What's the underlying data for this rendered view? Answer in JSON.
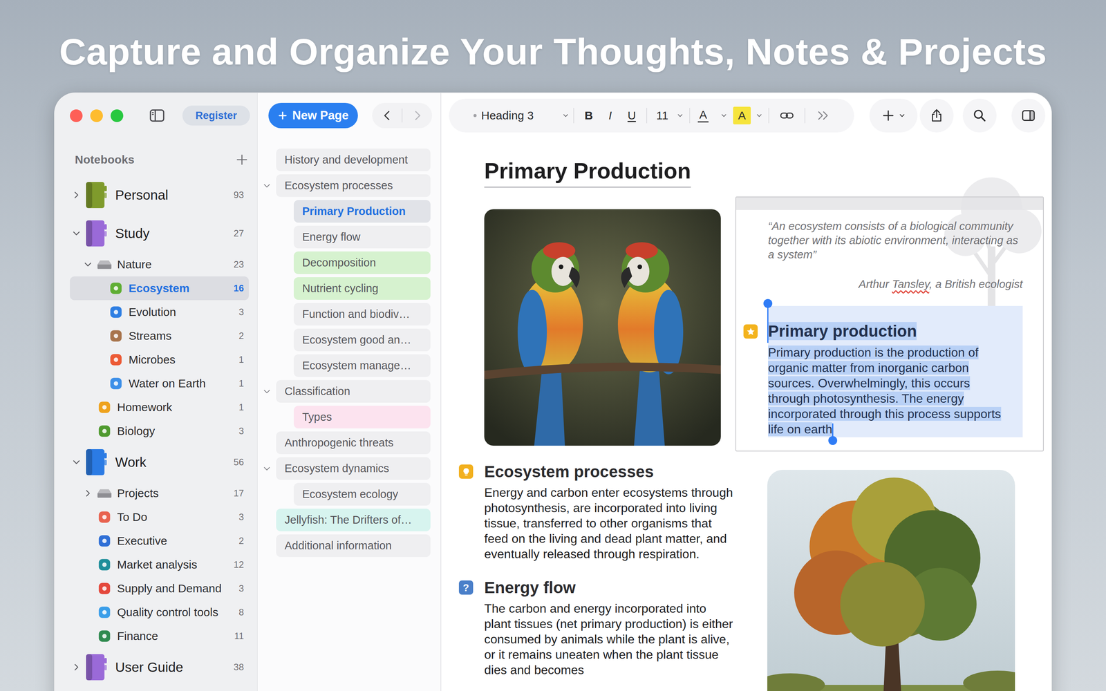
{
  "headline": "Capture and Organize Your Thoughts, Notes & Projects",
  "sidebar": {
    "register_button": "Register",
    "section_title": "Notebooks",
    "items": [
      {
        "label": "Personal",
        "count": "93",
        "kind": "notebook",
        "depth": 0,
        "collapsible": true,
        "expanded": false,
        "selected": false,
        "color": "#7f9b2c"
      },
      {
        "label": "Study",
        "count": "27",
        "kind": "notebook",
        "depth": 0,
        "collapsible": true,
        "expanded": true,
        "selected": false,
        "color": "#9a6ad8"
      },
      {
        "label": "Nature",
        "count": "23",
        "kind": "folder",
        "depth": 1,
        "collapsible": true,
        "expanded": true,
        "selected": false,
        "color": "#8e8e93"
      },
      {
        "label": "Ecosystem",
        "count": "16",
        "kind": "section",
        "depth": 2,
        "collapsible": false,
        "expanded": false,
        "selected": true,
        "color": "#5fae33"
      },
      {
        "label": "Evolution",
        "count": "3",
        "kind": "section",
        "depth": 2,
        "collapsible": false,
        "expanded": false,
        "selected": false,
        "color": "#2f7fe3"
      },
      {
        "label": "Streams",
        "count": "2",
        "kind": "section",
        "depth": 2,
        "collapsible": false,
        "expanded": false,
        "selected": false,
        "color": "#a8744c"
      },
      {
        "label": "Microbes",
        "count": "1",
        "kind": "section",
        "depth": 2,
        "collapsible": false,
        "expanded": false,
        "selected": false,
        "color": "#ec5a35"
      },
      {
        "label": "Water on Earth",
        "count": "1",
        "kind": "section",
        "depth": 2,
        "collapsible": false,
        "expanded": false,
        "selected": false,
        "color": "#3c8fe8"
      },
      {
        "label": "Homework",
        "count": "1",
        "kind": "section",
        "depth": 1,
        "collapsible": false,
        "expanded": false,
        "selected": false,
        "color": "#eea21c"
      },
      {
        "label": "Biology",
        "count": "3",
        "kind": "section",
        "depth": 1,
        "collapsible": false,
        "expanded": false,
        "selected": false,
        "color": "#4f9a2f"
      },
      {
        "label": "Work",
        "count": "56",
        "kind": "notebook",
        "depth": 0,
        "collapsible": true,
        "expanded": true,
        "selected": false,
        "color": "#2b7be4"
      },
      {
        "label": "Projects",
        "count": "17",
        "kind": "folder",
        "depth": 1,
        "collapsible": true,
        "expanded": false,
        "selected": false,
        "color": "#8e8e93"
      },
      {
        "label": "To Do",
        "count": "3",
        "kind": "section",
        "depth": 1,
        "collapsible": false,
        "expanded": false,
        "selected": false,
        "color": "#e8624f"
      },
      {
        "label": "Executive",
        "count": "2",
        "kind": "section",
        "depth": 1,
        "collapsible": false,
        "expanded": false,
        "selected": false,
        "color": "#2f6fd6"
      },
      {
        "label": "Market analysis",
        "count": "12",
        "kind": "section",
        "depth": 1,
        "collapsible": false,
        "expanded": false,
        "selected": false,
        "color": "#1d8e9a"
      },
      {
        "label": "Supply and Demand",
        "count": "3",
        "kind": "section",
        "depth": 1,
        "collapsible": false,
        "expanded": false,
        "selected": false,
        "color": "#e4483c"
      },
      {
        "label": "Quality control tools",
        "count": "8",
        "kind": "section",
        "depth": 1,
        "collapsible": false,
        "expanded": false,
        "selected": false,
        "color": "#3a9ee9"
      },
      {
        "label": "Finance",
        "count": "11",
        "kind": "section",
        "depth": 1,
        "collapsible": false,
        "expanded": false,
        "selected": false,
        "color": "#2f8a4f"
      },
      {
        "label": "User Guide",
        "count": "38",
        "kind": "notebook",
        "depth": 0,
        "collapsible": true,
        "expanded": false,
        "selected": false,
        "color": "#9a6ad8"
      }
    ]
  },
  "page_list": {
    "new_page_button": "New Page",
    "back_enabled": true,
    "forward_enabled": false,
    "pages": [
      {
        "title": "History and development",
        "depth": 0,
        "expandable": false,
        "expanded": false,
        "selected": false,
        "color": "#efeff1"
      },
      {
        "title": "Ecosystem processes",
        "depth": 0,
        "expandable": true,
        "expanded": true,
        "selected": false,
        "color": "#efeff1"
      },
      {
        "title": "Primary Production",
        "depth": 1,
        "expandable": false,
        "expanded": false,
        "selected": true,
        "color": "#e1e3e8"
      },
      {
        "title": "Energy flow",
        "depth": 1,
        "expandable": false,
        "expanded": false,
        "selected": false,
        "color": "#efeff1"
      },
      {
        "title": "Decomposition",
        "depth": 1,
        "expandable": false,
        "expanded": false,
        "selected": false,
        "color": "#d6f2cf"
      },
      {
        "title": "Nutrient cycling",
        "depth": 1,
        "expandable": false,
        "expanded": false,
        "selected": false,
        "color": "#d6f2cf"
      },
      {
        "title": "Function and biodiv…",
        "depth": 1,
        "expandable": false,
        "expanded": false,
        "selected": false,
        "color": "#efeff1"
      },
      {
        "title": "Ecosystem good an…",
        "depth": 1,
        "expandable": false,
        "expanded": false,
        "selected": false,
        "color": "#efeff1"
      },
      {
        "title": "Ecosystem manage…",
        "depth": 1,
        "expandable": false,
        "expanded": false,
        "selected": false,
        "color": "#efeff1"
      },
      {
        "title": "Classification",
        "depth": 0,
        "expandable": true,
        "expanded": true,
        "selected": false,
        "color": "#efeff1"
      },
      {
        "title": "Types",
        "depth": 1,
        "expandable": false,
        "expanded": false,
        "selected": false,
        "color": "#fce3ef"
      },
      {
        "title": "Anthropogenic threats",
        "depth": 0,
        "expandable": false,
        "expanded": false,
        "selected": false,
        "color": "#efeff1"
      },
      {
        "title": "Ecosystem dynamics",
        "depth": 0,
        "expandable": true,
        "expanded": true,
        "selected": false,
        "color": "#efeff1"
      },
      {
        "title": "Ecosystem ecology",
        "depth": 1,
        "expandable": false,
        "expanded": false,
        "selected": false,
        "color": "#efeff1"
      },
      {
        "title": "Jellyfish: The Drifters of…",
        "depth": 0,
        "expandable": false,
        "expanded": false,
        "selected": false,
        "color": "#d7f4ef"
      },
      {
        "title": "Additional information",
        "depth": 0,
        "expandable": false,
        "expanded": false,
        "selected": false,
        "color": "#efeff1"
      }
    ]
  },
  "toolbar": {
    "paragraph_style": "Heading 3",
    "styles": [
      {
        "label": "B",
        "kind": "bold"
      },
      {
        "label": "I",
        "kind": "italic"
      },
      {
        "label": "U",
        "kind": "underline"
      }
    ],
    "font_size": "11",
    "colors": [
      {
        "label": "A",
        "kind": "text",
        "color": "#3a3a3c"
      },
      {
        "label": "A",
        "kind": "highlight",
        "color": "#f6e43c"
      }
    ]
  },
  "document": {
    "title": "Primary Production",
    "quote": {
      "text": "“An ecosystem consists of a biological community together with its abiotic environment, interacting as a system”",
      "attribution": [
        {
          "text": "Arthur ",
          "misspelled": false
        },
        {
          "text": "Tansley",
          "misspelled": true
        },
        {
          "text": ", a British ecologist",
          "misspelled": false
        }
      ]
    },
    "note": {
      "heading": "Primary production",
      "body": "Primary production is the production of organic matter from inorganic carbon sources. Overwhelmingly, this occurs through photosynthesis. The energy incorporated through this process supports life on earth",
      "selected": true,
      "badge": {
        "kind": "star",
        "color": "#f3b31d"
      }
    },
    "sections": [
      {
        "heading": "Ecosystem processes",
        "body": "Energy and carbon enter ecosystems through photosynthesis, are incorporated into living tissue, transferred to other organisms that feed on the living and dead plant matter, and eventually released through respiration.",
        "badge": {
          "kind": "idea",
          "color": "#f2b01e"
        }
      },
      {
        "heading": "Energy flow",
        "body": "The carbon and energy incorporated into plant tissues (net primary production) is either consumed by animals while the plant is alive, or it remains uneaten when the plant tissue dies and becomes",
        "badge": {
          "kind": "question",
          "label": "?",
          "color": "#4a7fc9"
        }
      }
    ]
  }
}
